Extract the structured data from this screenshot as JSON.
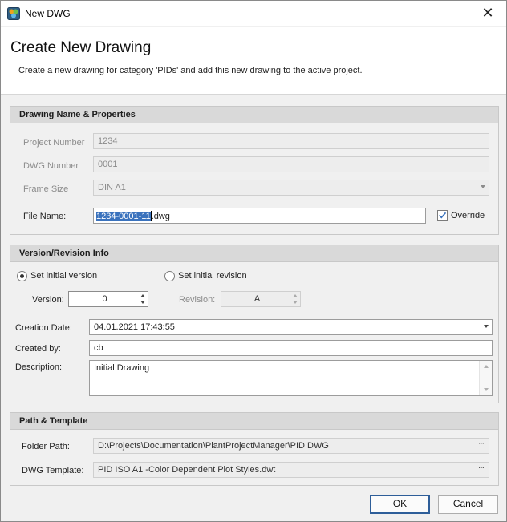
{
  "window": {
    "title": "New DWG",
    "close_glyph": "✕"
  },
  "header": {
    "title": "Create New Drawing",
    "subtitle": "Create a new drawing for category 'PIDs' and add this new drawing to the active project."
  },
  "name_props": {
    "heading": "Drawing Name & Properties",
    "project_number_label": "Project Number",
    "project_number_value": "1234",
    "dwg_number_label": "DWG Number",
    "dwg_number_value": "0001",
    "frame_size_label": "Frame Size",
    "frame_size_value": "DIN A1",
    "file_name_label": "File Name:",
    "file_name_selected": "1234-0001-11",
    "file_name_rest": ".dwg",
    "override_label": "Override",
    "override_checked": true
  },
  "version_info": {
    "heading": "Version/Revision Info",
    "set_version_label": "Set initial version",
    "set_revision_label": "Set initial revision",
    "selected_option": "version",
    "version_label": "Version:",
    "version_value": "0",
    "revision_label": "Revision:",
    "revision_value": "A",
    "creation_date_label": "Creation Date:",
    "creation_date_value": "04.01.2021 17:43:55",
    "created_by_label": "Created by:",
    "created_by_value": "cb",
    "description_label": "Description:",
    "description_value": "Initial Drawing"
  },
  "path_template": {
    "heading": "Path & Template",
    "folder_path_label": "Folder Path:",
    "folder_path_value": "D:\\Projects\\Documentation\\PlantProjectManager\\PID DWG",
    "dwg_template_label": "DWG Template:",
    "dwg_template_value": "PID ISO A1 -Color Dependent Plot Styles.dwt",
    "browse_glyph": "···"
  },
  "buttons": {
    "ok": "OK",
    "cancel": "Cancel"
  },
  "colors": {
    "selection": "#3a72bd",
    "default_button_border": "#2e5e99",
    "check_mark": "#3a72bd"
  },
  "icons": {
    "app": "new-dwg-app-icon",
    "close": "close-icon",
    "check": "checkmark-icon"
  }
}
